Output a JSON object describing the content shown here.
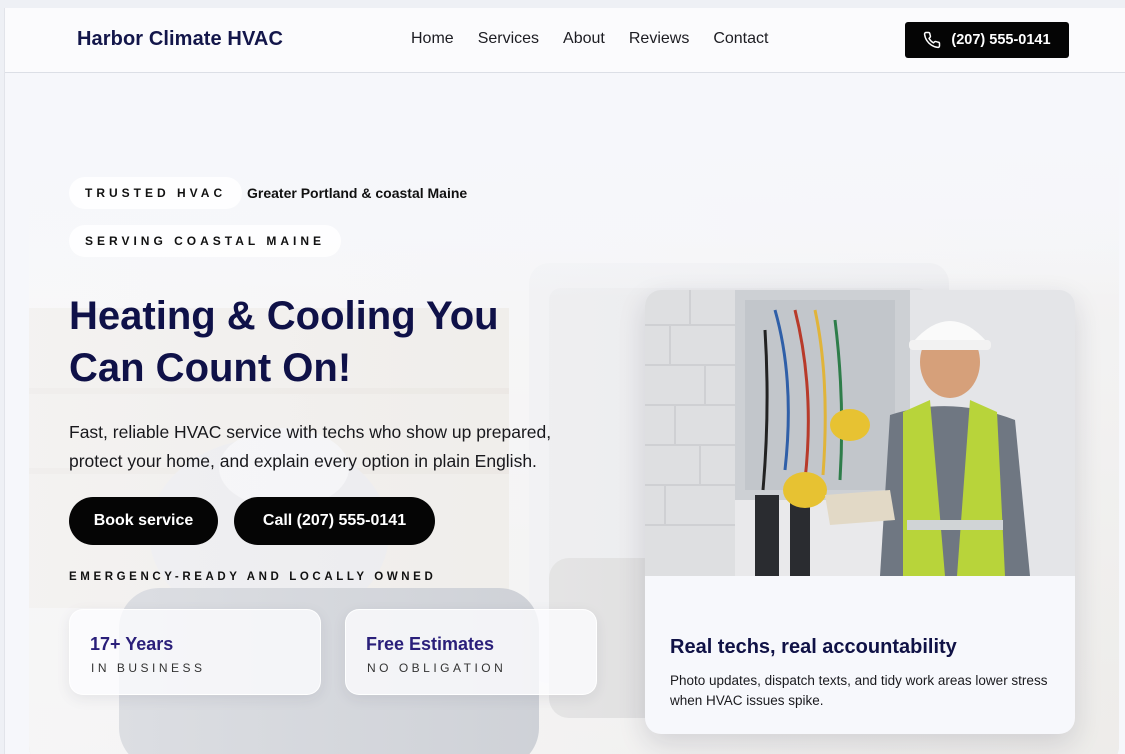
{
  "header": {
    "brand": "Harbor Climate HVAC",
    "nav": [
      "Home",
      "Services",
      "About",
      "Reviews",
      "Contact"
    ],
    "phone_label": "(207) 555-0141"
  },
  "hero": {
    "pill_trusted": "TRUSTED HVAC",
    "region": "Greater Portland & coastal Maine",
    "pill_serving": "SERVING COASTAL MAINE",
    "headline_line1": "Heating & Cooling You",
    "headline_line2": "Can Count On!",
    "lede_line1": "Fast, reliable HVAC service with techs who show up prepared,",
    "lede_line2": "protect your home, and explain every option in plain English.",
    "book_label": "Book service",
    "call_label": "Call (207) 555-0141",
    "emergency": "EMERGENCY-READY AND LOCALLY OWNED",
    "stats": [
      {
        "value": "17+ Years",
        "sub": "IN BUSINESS"
      },
      {
        "value": "Free Estimates",
        "sub": "NO OBLIGATION"
      }
    ]
  },
  "card": {
    "title": "Real techs, real accountability",
    "text": "Photo updates, dispatch texts, and tidy work areas lower stress when HVAC issues spike."
  },
  "icons": {
    "phone": "phone-icon"
  },
  "colors": {
    "brand_navy": "#13164a",
    "button_black": "#050505",
    "stat_purple": "#2a1f7a"
  }
}
